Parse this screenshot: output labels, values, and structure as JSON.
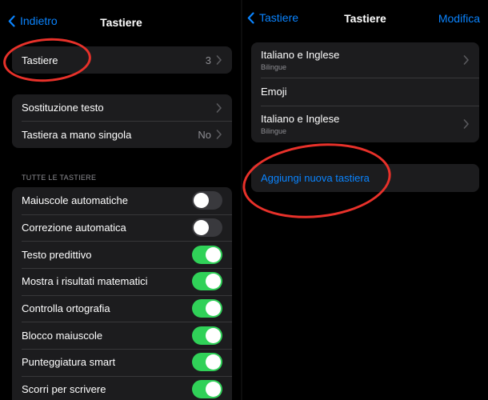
{
  "left": {
    "nav": {
      "back_label": "Indietro",
      "title": "Tastiere"
    },
    "keyboards_row": {
      "label": "Tastiere",
      "count": "3"
    },
    "group2": [
      {
        "label": "Sostituzione testo",
        "value": ""
      },
      {
        "label": "Tastiera a mano singola",
        "value": "No"
      }
    ],
    "section_header": "TUTTE LE TASTIERE",
    "toggles": [
      {
        "label": "Maiuscole automatiche",
        "on": false
      },
      {
        "label": "Correzione automatica",
        "on": false
      },
      {
        "label": "Testo predittivo",
        "on": true
      },
      {
        "label": "Mostra i risultati matematici",
        "on": true
      },
      {
        "label": "Controlla ortografia",
        "on": true
      },
      {
        "label": "Blocco maiuscole",
        "on": true
      },
      {
        "label": "Punteggiatura smart",
        "on": true
      },
      {
        "label": "Scorri per scrivere",
        "on": true
      }
    ]
  },
  "right": {
    "nav": {
      "back_label": "Tastiere",
      "title": "Tastiere",
      "action_label": "Modifica"
    },
    "keyboards": [
      {
        "label": "Italiano e Inglese",
        "sub": "Bilingue"
      },
      {
        "label": "Emoji",
        "sub": ""
      },
      {
        "label": "Italiano e Inglese",
        "sub": "Bilingue"
      }
    ],
    "add_keyboard_label": "Aggiungi nuova tastiera"
  },
  "colors": {
    "accent": "#0a84ff",
    "toggle_on": "#30d158",
    "toggle_off": "#39393d",
    "annotation": "#e8312a"
  }
}
